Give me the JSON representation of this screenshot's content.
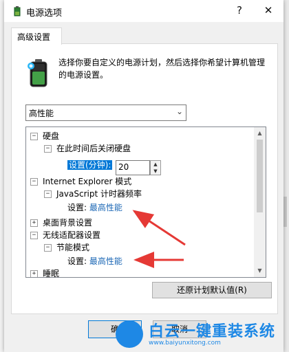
{
  "window": {
    "title": "电源选项",
    "help_glyph": "?",
    "close_glyph": "✕"
  },
  "tab": {
    "label": "高级设置"
  },
  "description": "选择你要自定义的电源计划，然后选择你希望计算机管理的电源设置。",
  "plan": {
    "selected": "高性能"
  },
  "tree": {
    "hard_disk": {
      "label": "硬盘",
      "expander": "⊟"
    },
    "disk_off": {
      "label": "在此时间后关闭硬盘",
      "expander": "⊟"
    },
    "disk_setting": {
      "label": "设置(分钟):",
      "value": "20"
    },
    "ie": {
      "label": "Internet Explorer 模式",
      "expander": "⊟"
    },
    "js_timer": {
      "label": "JavaScript 计时器频率",
      "expander": "⊟"
    },
    "js_setting": {
      "label": "设置:",
      "value": "最高性能"
    },
    "desktop_bg": {
      "label": "桌面背景设置",
      "expander": "⊞"
    },
    "wireless": {
      "label": "无线适配器设置",
      "expander": "⊟"
    },
    "power_save": {
      "label": "节能模式",
      "expander": "⊟"
    },
    "ps_setting": {
      "label": "设置:",
      "value": "最高性能"
    },
    "sleep": {
      "label": "睡眠",
      "expander": "⊞"
    }
  },
  "buttons": {
    "restore": "还原计划默认值(R)",
    "ok": "确",
    "cancel": "取消"
  },
  "watermark": {
    "text": "白云一键重装系统",
    "url": "www.baiyunxitong.com"
  },
  "colors": {
    "accent": "#0078d7",
    "link": "#1b67b5",
    "arrow": "#e53935",
    "watermark": "#1e88e5"
  }
}
